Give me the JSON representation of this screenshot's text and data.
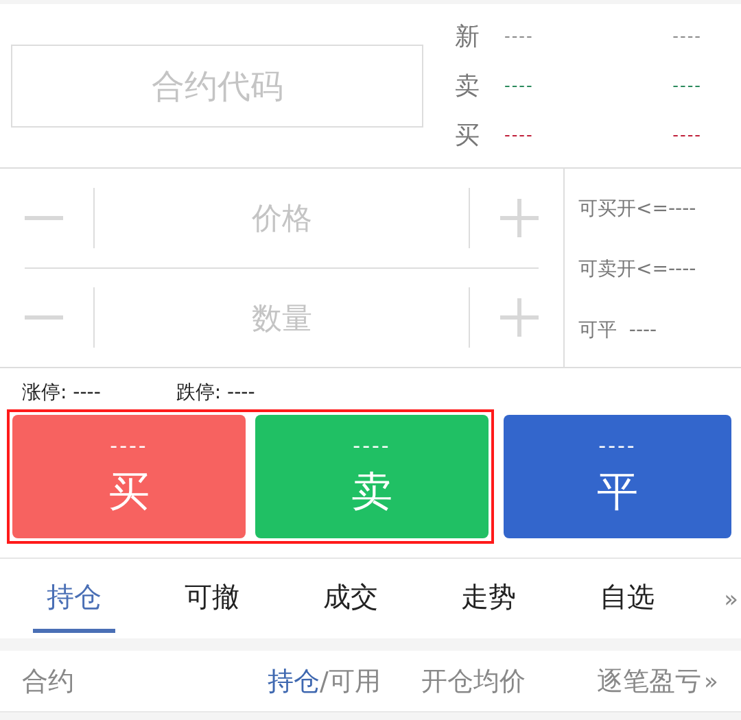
{
  "contract_field": {
    "placeholder": "合约代码"
  },
  "quotes": [
    {
      "label": "新",
      "left": "----",
      "right": "----",
      "color": "#8a8a8a"
    },
    {
      "label": "卖",
      "left": "----",
      "right": "----",
      "color": "#2a8a5c"
    },
    {
      "label": "买",
      "left": "----",
      "right": "----",
      "color": "#c0203a"
    }
  ],
  "inputs": [
    {
      "placeholder": "价格"
    },
    {
      "placeholder": "数量"
    }
  ],
  "available": [
    {
      "text": "可买开<=----"
    },
    {
      "text": "可卖开<=----"
    },
    {
      "text": "可平  ----"
    }
  ],
  "limits": [
    {
      "text": "涨停: ----"
    },
    {
      "text": "跌停: ----"
    }
  ],
  "actions": [
    {
      "price": "----",
      "label": "买",
      "color": "#f76260",
      "highlighted": true
    },
    {
      "price": "----",
      "label": "卖",
      "color": "#20c064",
      "highlighted": true
    },
    {
      "price": "----",
      "label": "平",
      "color": "#3366cc",
      "highlighted": false
    }
  ],
  "tabs": [
    {
      "label": "持仓",
      "selected": true
    },
    {
      "label": "可撤",
      "selected": false
    },
    {
      "label": "成交",
      "selected": false
    },
    {
      "label": "走势",
      "selected": false
    },
    {
      "label": "自选",
      "selected": false
    }
  ],
  "tabs_more": "»",
  "columns": [
    {
      "parts": [
        {
          "text": "合约",
          "selected": false
        }
      ]
    },
    {
      "parts": [
        {
          "text": "持仓",
          "selected": true
        },
        {
          "text": "/可用",
          "selected": false
        }
      ]
    },
    {
      "parts": [
        {
          "text": "开仓均价",
          "selected": false
        }
      ]
    },
    {
      "parts": [
        {
          "text": "逐笔盈亏",
          "selected": false
        }
      ]
    }
  ],
  "columns_more": "»"
}
